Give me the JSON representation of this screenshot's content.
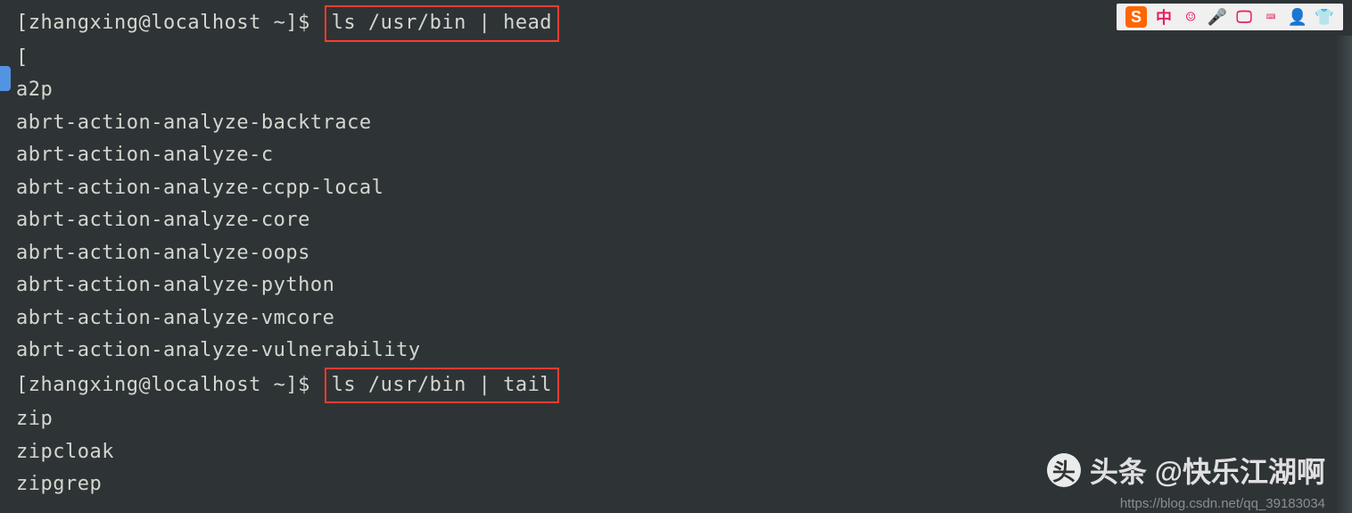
{
  "prompt1": {
    "text": "[zhangxing@localhost ~]$ ",
    "command": "ls /usr/bin | head"
  },
  "output1": {
    "lines": [
      "[",
      "a2p",
      "abrt-action-analyze-backtrace",
      "abrt-action-analyze-c",
      "abrt-action-analyze-ccpp-local",
      "abrt-action-analyze-core",
      "abrt-action-analyze-oops",
      "abrt-action-analyze-python",
      "abrt-action-analyze-vmcore",
      "abrt-action-analyze-vulnerability"
    ]
  },
  "prompt2": {
    "text": "[zhangxing@localhost ~]$ ",
    "command": "ls /usr/bin | tail"
  },
  "output2": {
    "lines": [
      "zip",
      "zipcloak",
      "zipgrep"
    ]
  },
  "ime": {
    "s": "S",
    "zhong": "中",
    "smile": "☺",
    "mic": "🎤",
    "monitor": "🖵",
    "keyboard": "⌨",
    "person": "👤",
    "shirt": "👕"
  },
  "watermark": {
    "logo": "头",
    "text": "头条 @快乐江湖啊",
    "url": "https://blog.csdn.net/qq_39183034"
  }
}
